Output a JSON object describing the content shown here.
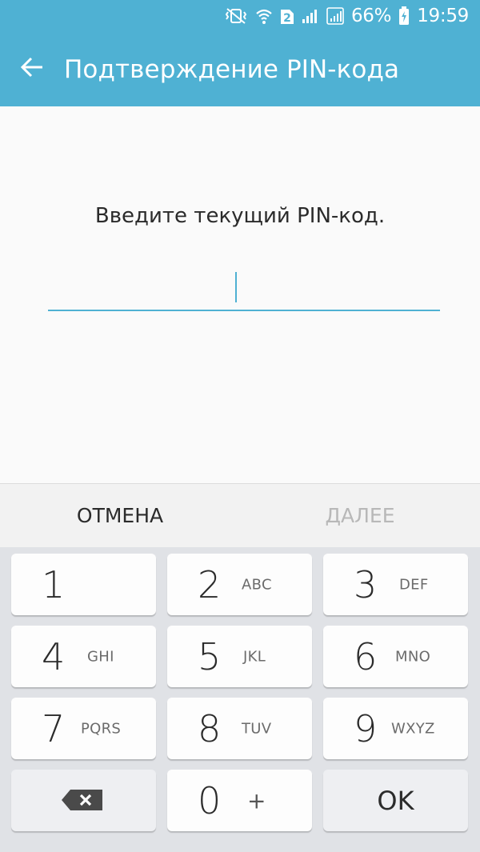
{
  "status_bar": {
    "icons": [
      "mute-vibrate-icon",
      "wifi-icon",
      "sim2-icon",
      "signal-icon",
      "signal-sim2-icon",
      "battery-charging-icon"
    ],
    "sim_badge": "2",
    "battery": "66%",
    "time": "19:59"
  },
  "app_bar": {
    "back_icon": "arrow-left-icon",
    "title": "Подтверждение PIN-кода"
  },
  "content": {
    "prompt": "Введите текущий PIN-код.",
    "pin_value": "",
    "accent_color": "#4fb1d3"
  },
  "actions": {
    "cancel": "ОТМЕНА",
    "next": "ДАЛЕЕ"
  },
  "keypad": {
    "keys": [
      {
        "digit": "1",
        "letters": ""
      },
      {
        "digit": "2",
        "letters": "ABC"
      },
      {
        "digit": "3",
        "letters": "DEF"
      },
      {
        "digit": "4",
        "letters": "GHI"
      },
      {
        "digit": "5",
        "letters": "JKL"
      },
      {
        "digit": "6",
        "letters": "MNO"
      },
      {
        "digit": "7",
        "letters": "PQRS"
      },
      {
        "digit": "8",
        "letters": "TUV"
      },
      {
        "digit": "9",
        "letters": "WXYZ"
      },
      {
        "digit": "0",
        "letters": "+"
      }
    ],
    "backspace_icon": "backspace-icon",
    "ok": "OK"
  }
}
